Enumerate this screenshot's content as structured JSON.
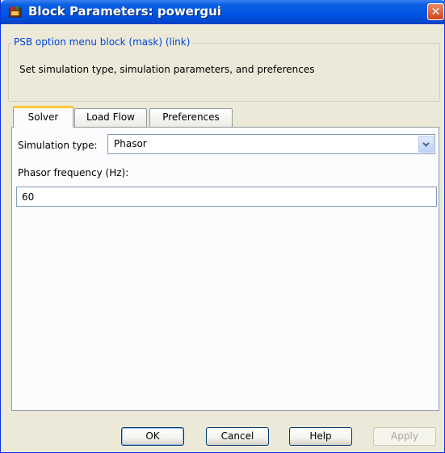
{
  "window": {
    "title": "Block Parameters: powergui",
    "close_symbol": "✕"
  },
  "description": {
    "group_title": "PSB option menu block (mask) (link)",
    "text": "Set simulation type, simulation parameters, and preferences"
  },
  "tabs": [
    {
      "label": "Solver",
      "active": true
    },
    {
      "label": "Load Flow",
      "active": false
    },
    {
      "label": "Preferences",
      "active": false
    }
  ],
  "solver": {
    "simulation_type_label": "Simulation type:",
    "simulation_type_value": "Phasor",
    "phasor_frequency_label": "Phasor frequency (Hz):",
    "phasor_frequency_value": "60"
  },
  "buttons": {
    "ok": "OK",
    "cancel": "Cancel",
    "help": "Help",
    "apply": "Apply"
  },
  "icons": {
    "app": "simulink-block-icon",
    "close": "close-icon",
    "dropdown": "chevron-down-icon"
  },
  "colors": {
    "titlebar": "#0054e3",
    "active_tab_accent": "#ffc83c",
    "group_title": "#0046d5",
    "dialog_bg": "#ece9d8"
  }
}
